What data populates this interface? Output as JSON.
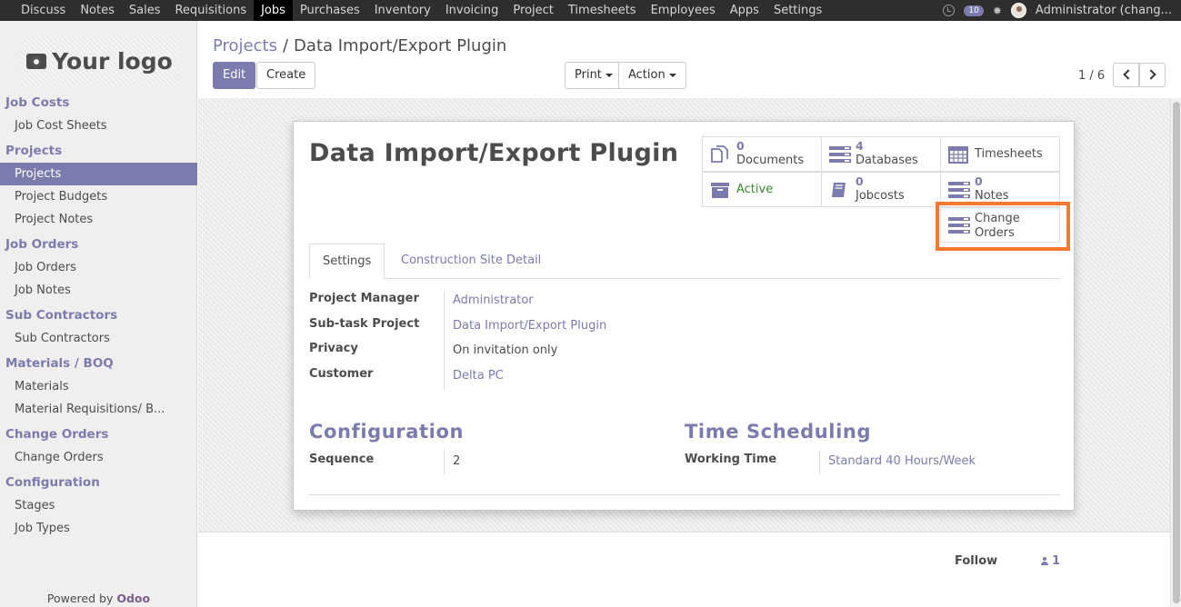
{
  "topbar": {
    "menu": [
      "Discuss",
      "Notes",
      "Sales",
      "Requisitions",
      "Jobs",
      "Purchases",
      "Inventory",
      "Invoicing",
      "Project",
      "Timesheets",
      "Employees",
      "Apps",
      "Settings"
    ],
    "active": "Jobs",
    "chat_count": "10",
    "user": "Administrator (chang..."
  },
  "sidebar": {
    "logo_text": "Your logo",
    "sections": [
      {
        "title": "Job Costs",
        "items": [
          "Job Cost Sheets"
        ]
      },
      {
        "title": "Projects",
        "items": [
          "Projects",
          "Project Budgets",
          "Project Notes"
        ]
      },
      {
        "title": "Job Orders",
        "items": [
          "Job Orders",
          "Job Notes"
        ]
      },
      {
        "title": "Sub Contractors",
        "items": [
          "Sub Contractors"
        ]
      },
      {
        "title": "Materials / BOQ",
        "items": [
          "Materials",
          "Material Requisitions/ B..."
        ]
      },
      {
        "title": "Change Orders",
        "items": [
          "Change Orders"
        ]
      },
      {
        "title": "Configuration",
        "items": [
          "Stages",
          "Job Types"
        ]
      }
    ],
    "active_item": "Projects",
    "powered_prefix": "Powered by",
    "powered_brand": "Odoo"
  },
  "control_panel": {
    "breadcrumb_parent": "Projects",
    "breadcrumb_sep": "/",
    "breadcrumb_current": "Data Import/Export Plugin",
    "edit_label": "Edit",
    "create_label": "Create",
    "print_label": "Print",
    "action_label": "Action",
    "pager": "1 / 6"
  },
  "form": {
    "title": "Data Import/Export Plugin",
    "smart_buttons": {
      "documents": {
        "value": "0",
        "label": "Documents"
      },
      "databases": {
        "value": "4",
        "label": "Databases"
      },
      "timesheets": {
        "label": "Timesheets"
      },
      "active": {
        "label": "Active"
      },
      "jobcosts": {
        "value": "0",
        "label": "Jobcosts"
      },
      "notes": {
        "value": "0",
        "label": "Notes"
      },
      "change_orders": {
        "label": "Change Orders"
      }
    },
    "tabs": {
      "settings": "Settings",
      "site_detail": "Construction Site Detail"
    },
    "fields": {
      "project_manager": {
        "label": "Project Manager",
        "value": "Administrator"
      },
      "subtask_project": {
        "label": "Sub-task Project",
        "value": "Data Import/Export Plugin"
      },
      "privacy": {
        "label": "Privacy",
        "value": "On invitation only"
      },
      "customer": {
        "label": "Customer",
        "value": "Delta PC"
      }
    },
    "configuration": {
      "title": "Configuration",
      "sequence_label": "Sequence",
      "sequence_value": "2"
    },
    "time_scheduling": {
      "title": "Time Scheduling",
      "working_time_label": "Working Time",
      "working_time_value": "Standard 40 Hours/Week"
    }
  },
  "chatter": {
    "follow_label": "Follow",
    "followers_count": "1"
  },
  "colors": {
    "accent": "#7c7bad",
    "highlight": "#f47a31",
    "active_green": "#3c8a2e",
    "navbar": "#2e2e2e"
  }
}
